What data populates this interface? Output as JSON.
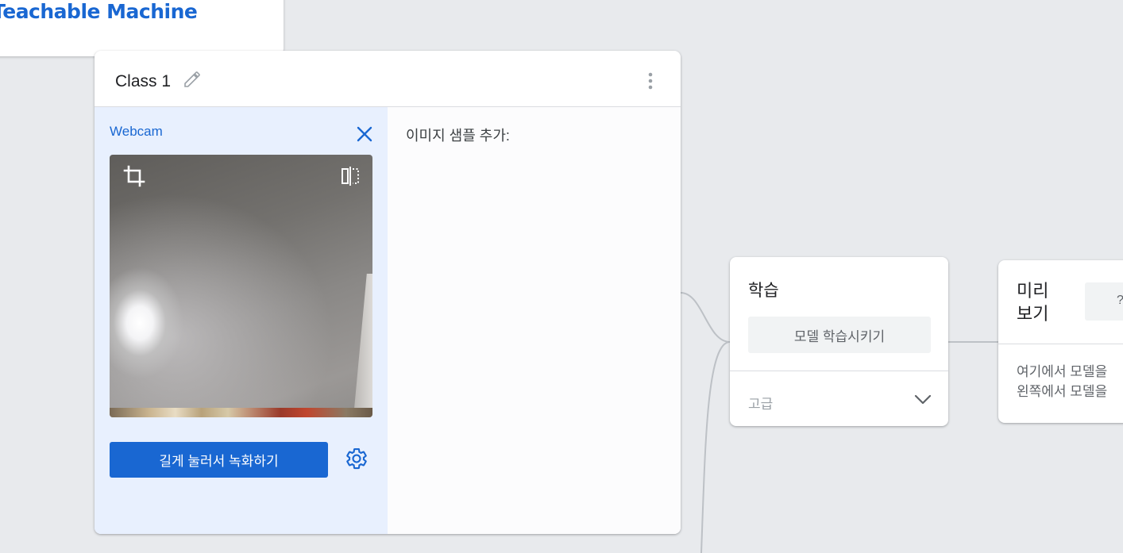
{
  "app": {
    "title": "Teachable Machine",
    "brand_color": "#1967d2"
  },
  "class_card": {
    "title": "Class 1",
    "icons": {
      "edit": "pencil-icon",
      "menu": "more-vert-icon"
    }
  },
  "webcam": {
    "label": "Webcam",
    "close_icon": "close-icon",
    "crop_icon": "crop-icon",
    "flip_icon": "flip-icon",
    "record_label": "길게 눌러서 녹화하기",
    "settings_icon": "gear-icon"
  },
  "samples": {
    "label": "이미지 샘플 추가:"
  },
  "training": {
    "title": "학습",
    "train_button": "모델 학습시키기",
    "advanced_label": "고급",
    "advanced_icon": "chevron-down-icon"
  },
  "preview": {
    "title_line1": "미리",
    "title_line2": "보기",
    "export_icon_text": "?",
    "desc_line1": "여기에서 모델을",
    "desc_line2": "왼쪽에서 모델을"
  }
}
